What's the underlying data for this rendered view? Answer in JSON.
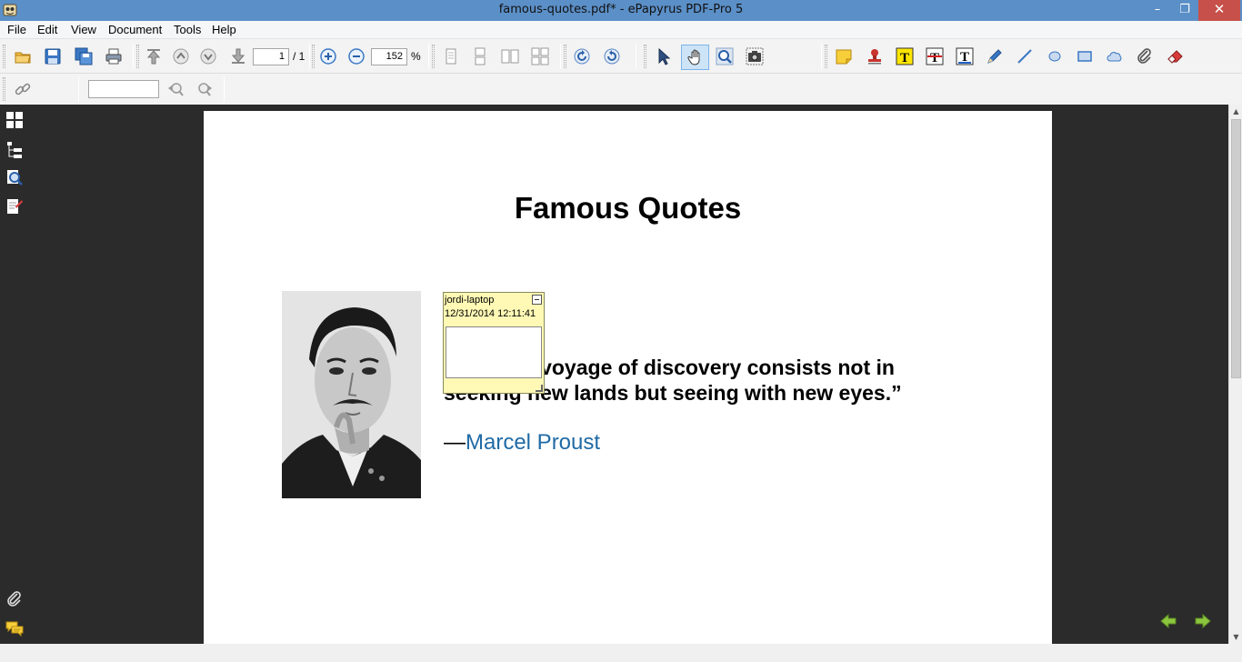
{
  "window": {
    "title": "famous-quotes.pdf* - ePapyrus PDF-Pro 5",
    "minimize": "–",
    "restore": "❐",
    "close": "✕"
  },
  "menu": [
    "File",
    "Edit",
    "View",
    "Document",
    "Tools",
    "Help"
  ],
  "toolbar": {
    "page_current": "1",
    "page_total": "/ 1",
    "zoom_value": "152",
    "zoom_unit": "%",
    "search_value": ""
  },
  "document": {
    "title": "Famous Quotes",
    "quote_line1": "“The real voyage of discovery consists not in",
    "quote_line2": "seeking new lands but seeing with new eyes.”",
    "author_dash": "—",
    "author_name": "Marcel Proust"
  },
  "note": {
    "author": "jordi-laptop",
    "datetime": "12/31/2014 12:11:41"
  },
  "colors": {
    "titlebar": "#5b8fc7",
    "close": "#c7504a",
    "link": "#1f6aa5",
    "note_bg": "#fff9b5",
    "workspace": "#2b2b2b"
  }
}
